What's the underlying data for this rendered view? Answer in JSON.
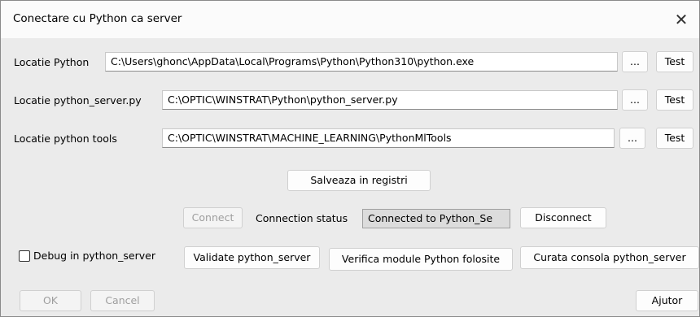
{
  "window": {
    "title": "Conectare cu Python ca server",
    "close_icon": "close-icon"
  },
  "rows": [
    {
      "label": "Locatie Python",
      "value": "C:\\Users\\ghonc\\AppData\\Local\\Programs\\Python\\Python310\\python.exe",
      "browse": "...",
      "test": "Test"
    },
    {
      "label": "Locatie python_server.py",
      "value": "C:\\OPTIC\\WINSTRAT\\Python\\python_server.py",
      "browse": "...",
      "test": "Test"
    },
    {
      "label": "Locatie python tools",
      "value": "C:\\OPTIC\\WINSTRAT\\MACHINE_LEARNING\\PythonMlTools",
      "browse": "...",
      "test": "Test"
    }
  ],
  "save_button": "Salveaza in registri",
  "connection": {
    "connect": "Connect",
    "status_label": "Connection status",
    "status_value": "Connected to Python_Se",
    "disconnect": "Disconnect"
  },
  "actions": {
    "debug_label": "Debug in python_server",
    "validate": "Validate python_server",
    "verify_modules": "Verifica module Python folosite",
    "clear_console": "Curata consola python_server"
  },
  "footer": {
    "ok": "OK",
    "cancel": "Cancel",
    "help": "Ajutor"
  }
}
